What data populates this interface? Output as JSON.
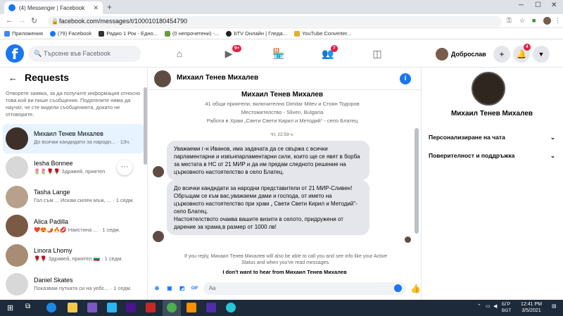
{
  "browser": {
    "tab_title": "(4) Messenger | Facebook",
    "url": "facebook.com/messages/t/100010180454790",
    "bookmarks": [
      {
        "label": "Приложения",
        "icon": "apps-icon"
      },
      {
        "label": "(79) Facebook",
        "icon": "facebook-icon"
      },
      {
        "label": "Радио 1 Рок - Едно...",
        "icon": "radio-icon"
      },
      {
        "label": "(0 непрочетени) -...",
        "icon": "mail-icon"
      },
      {
        "label": "bTV Онлайн | Гледа...",
        "icon": "btv-icon"
      },
      {
        "label": "YouTube Converter...",
        "icon": "youtube-icon"
      }
    ]
  },
  "fb_header": {
    "search_placeholder": "Търсене във Facebook",
    "watch_badge": "9+",
    "groups_badge": "7",
    "user_name": "Доброслав",
    "notifications_badge": "4"
  },
  "requests": {
    "title": "Requests",
    "note": "Отворете заявка, за да получите информация относно това кой ви пише съобщения. Подателите няма да научат, че сте видели съобщенията, докато не отговорите.",
    "items": [
      {
        "name": "Михаил Тенев Михалев",
        "preview": "До всички кандидати за народн...",
        "time": "· 13ч.",
        "avatar_color": "#3e3029"
      },
      {
        "name": "Iesha Bonnee",
        "preview": "🌷🌷🌹🌹 Здравей, приятел",
        "time": "",
        "avatar_color": "#d8d8d8"
      },
      {
        "name": "Tasha Lange",
        "preview": "Гол съм ... Искам силен мъж, ...",
        "time": "· 1 седм.",
        "avatar_color": "#b8a18c"
      },
      {
        "name": "Alica Padilla",
        "preview": "❤️😍🌶️🔥💋 Наистина ...",
        "time": "· 1 седм.",
        "avatar_color": "#7a5a44"
      },
      {
        "name": "Linora Lhomy",
        "preview": "🌹🌹 Здравей, приятел 🇧🇬",
        "time": "· 1 седм.",
        "avatar_color": "#a98c74"
      },
      {
        "name": "Daniel Skates",
        "preview": "Показвам путката си на уебс...",
        "time": "· 1 седм.",
        "avatar_color": "#d8d8d8"
      }
    ]
  },
  "chat": {
    "name": "Михаил Тенев Михалев",
    "profile_name": "Михаил Тенев Михалев",
    "mutual": "41 общи приятели, включително Dimitar Mitev и Стоян Тодоров",
    "location": "Местожителство - Sliven, Bulgaria",
    "work": "Работи в Храм „Свети Свети Кирил и Методий“ - село Блатец",
    "timestamp": "Чт, 22:59 ч.",
    "message1": "Уважаеми г-н Иванов, има задачата да се свържа с всички парламентарни и извънпарламентарни сили, които ще се явят в борба за местата в НС от 21 МИР и да им предам следното решение на църковното настоятелство в село Блатец.",
    "message2_lines": [
      "До всички кандидати за народни представители от 21 МИР-Сливен!",
      "Обръщам се към вас,уважаеми дами и господа, от името на църковното настоятелство при храм „ Свети Свети Кирил и Методий\"- село Блатец.",
      "Настоятелството очаква вашите визити в селото, придружени от дарение за храма,в размер от 1000 лв!"
    ],
    "notice": "If you reply, Михаил Тенев Михалев will also be able to call you and see info like your Active Status and when you've read messages.",
    "dont_want": "I don't want to hear from Михаил Тенев Михалев",
    "input_placeholder": "Aa"
  },
  "right_panel": {
    "name": "Михаил Тенев Михалев",
    "option1": "Персонализиране на чата",
    "option2": "Поверителност и поддръжка"
  },
  "taskbar": {
    "lang1": "БГР",
    "lang2": "BGT",
    "time": "12:41 PM",
    "date": "3/5/2021"
  }
}
